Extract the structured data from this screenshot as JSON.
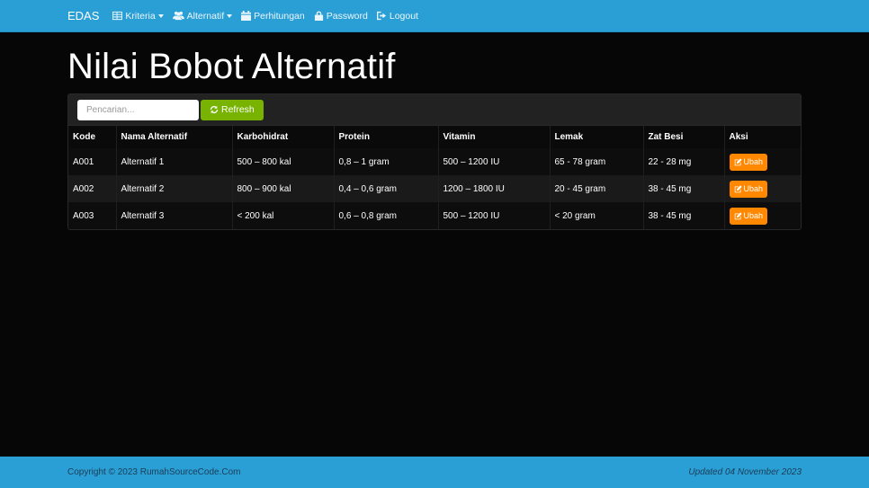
{
  "navbar": {
    "brand": "EDAS",
    "items": [
      {
        "label": "Kriteria",
        "icon": "table-icon",
        "dropdown": true
      },
      {
        "label": "Alternatif",
        "icon": "users-icon",
        "dropdown": true
      },
      {
        "label": "Perhitungan",
        "icon": "calendar-icon",
        "dropdown": false
      },
      {
        "label": "Password",
        "icon": "lock-icon",
        "dropdown": false
      },
      {
        "label": "Logout",
        "icon": "sign-out-icon",
        "dropdown": false
      }
    ]
  },
  "page": {
    "title": "Nilai Bobot Alternatif"
  },
  "toolbar": {
    "search_placeholder": "Pencarian...",
    "refresh_label": "Refresh"
  },
  "table": {
    "headers": [
      "Kode",
      "Nama Alternatif",
      "Karbohidrat",
      "Protein",
      "Vitamin",
      "Lemak",
      "Zat Besi",
      "Aksi"
    ],
    "rows": [
      {
        "kode": "A001",
        "nama": "Alternatif 1",
        "karbohidrat": "500 – 800 kal",
        "protein": "0,8 – 1 gram",
        "vitamin": "500 – 1200 IU",
        "lemak": "65 - 78 gram",
        "zat_besi": "22 - 28 mg",
        "aksi": "Ubah"
      },
      {
        "kode": "A002",
        "nama": "Alternatif 2",
        "karbohidrat": "800 – 900 kal",
        "protein": "0,4 – 0,6 gram",
        "vitamin": "1200 – 1800 IU",
        "lemak": "20 - 45 gram",
        "zat_besi": "38 - 45 mg",
        "aksi": "Ubah"
      },
      {
        "kode": "A003",
        "nama": "Alternatif 3",
        "karbohidrat": "< 200 kal",
        "protein": "0,6 – 0,8 gram",
        "vitamin": "500 – 1200 IU",
        "lemak": "< 20 gram",
        "zat_besi": "38 - 45 mg",
        "aksi": "Ubah"
      }
    ]
  },
  "footer": {
    "copyright": "Copyright © 2023 RumahSourceCode.Com",
    "updated": "Updated 04 November 2023"
  },
  "colors": {
    "primary": "#2a9fd6",
    "success": "#77b300",
    "warning": "#ff8800",
    "background": "#060606"
  }
}
